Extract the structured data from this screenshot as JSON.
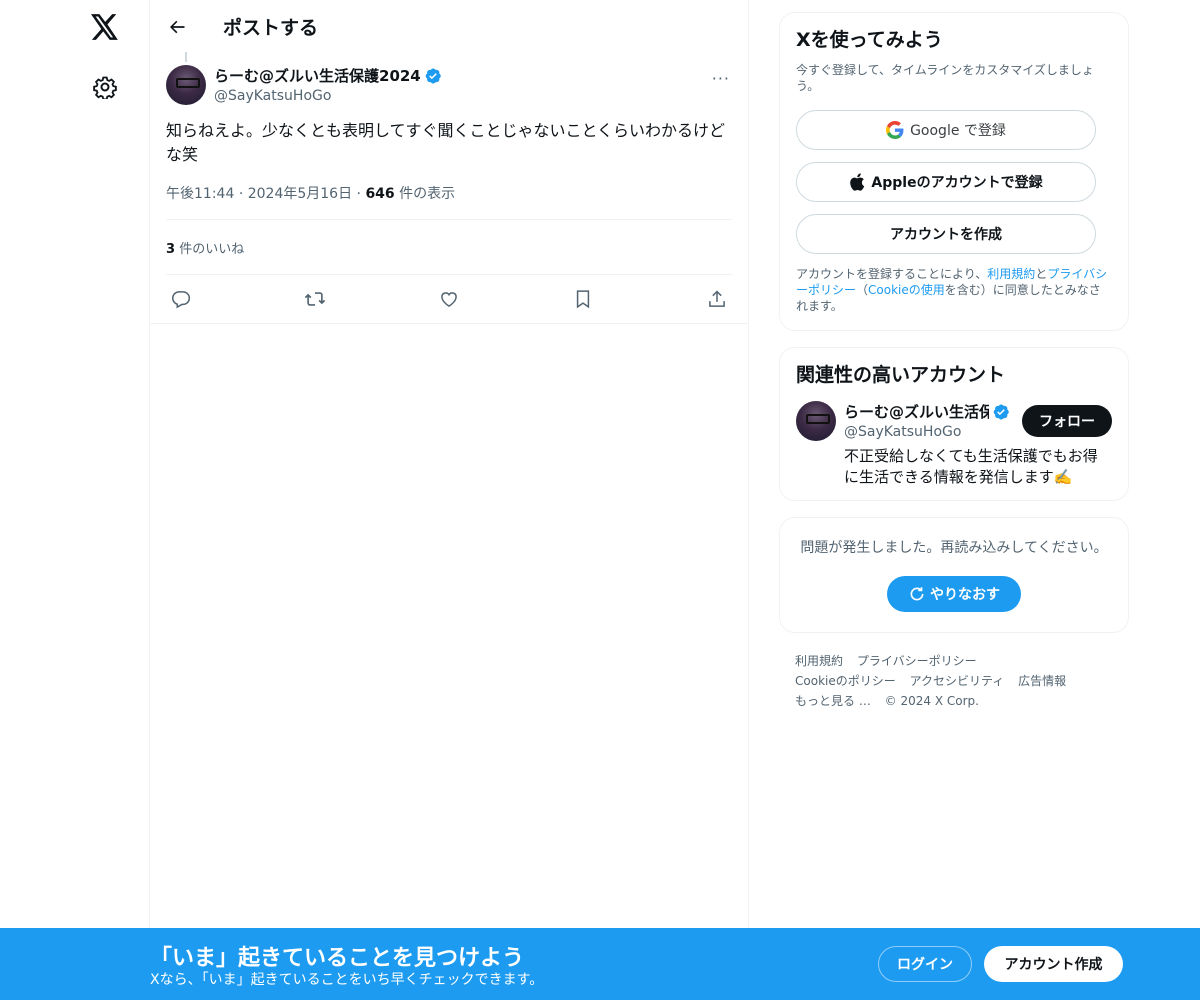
{
  "nav": {
    "logo_icon": "x-logo-icon",
    "settings_icon": "gear-icon"
  },
  "header": {
    "title": "ポストする",
    "back_icon": "arrow-left-icon"
  },
  "tweet": {
    "author_name": "らーむ@ズルい生活保護2024",
    "author_handle": "@SayKatsuHoGo",
    "more_label": "···",
    "text": "知らねえよ。少なくとも表明してすぐ聞くことじゃないことくらいわかるけどな笑",
    "time": "午後11:44",
    "separator": "·",
    "date": "2024年5月16日",
    "views_count": "646",
    "views_label": "件の表示",
    "likes_count": "3",
    "likes_label": "件のいいね",
    "actions": [
      "reply-icon",
      "retweet-icon",
      "like-icon",
      "bookmark-icon",
      "share-icon"
    ]
  },
  "signup_card": {
    "title": "Xを使ってみよう",
    "subtitle": "今すぐ登録して、タイムラインをカスタマイズしましょう。",
    "google_label": "Google で登録",
    "apple_label": "Appleのアカウントで登録",
    "create_label": "アカウントを作成",
    "legal_pre": "アカウントを登録することにより、",
    "legal_terms": "利用規約",
    "legal_and": "と",
    "legal_privacy": "プライバシーポリシー",
    "legal_paren_open": "（",
    "legal_cookie": "Cookieの使用",
    "legal_post": "を含む）に同意したとみなされます。"
  },
  "related_card": {
    "title": "関連性の高いアカウント",
    "account_name": "らーむ@ズルい生活保",
    "account_handle": "@SayKatsuHoGo",
    "account_bio": "不正受給しなくても生活保護でもお得に生活できる情報を発信します✍️",
    "follow_label": "フォロー"
  },
  "error_card": {
    "message": "問題が発生しました。再読み込みしてください。",
    "retry_label": "やりなおす"
  },
  "footer": {
    "links": [
      "利用規約",
      "プライバシーポリシー",
      "Cookieのポリシー",
      "アクセシビリティ",
      "広告情報",
      "もっと見る …"
    ],
    "copyright": "© 2024 X Corp."
  },
  "banner": {
    "title": "「いま」起きていることを見つけよう",
    "subtitle": "Xなら、「いま」起きていることをいち早くチェックできます。",
    "login_label": "ログイン",
    "signup_label": "アカウント作成"
  },
  "colors": {
    "accent": "#1d9bf0",
    "text": "#0f1419",
    "muted": "#536471"
  }
}
